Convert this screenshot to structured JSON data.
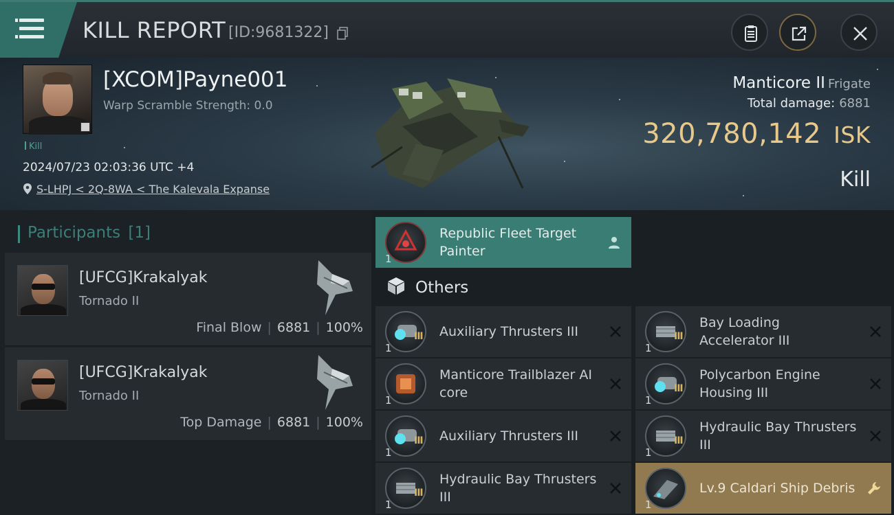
{
  "header": {
    "title": "KILL REPORT",
    "report_id": "[ID:9681322]"
  },
  "victim": {
    "name": "[XCOM]Payne001",
    "warp_scramble": "Warp Scramble Strength: 0.0",
    "kill_tag": "Kill",
    "timestamp": "2024/07/23 02:03:36 UTC +4",
    "location": "S-LHPJ < 2Q-8WA < The Kalevala Expanse"
  },
  "summary": {
    "ship": "Manticore II",
    "ship_class": "Frigate",
    "total_damage_label": "Total damage:",
    "total_damage": "6881",
    "isk_value": "320,780,142",
    "isk_unit": "ISK",
    "result": "Kill"
  },
  "participants": {
    "title": "Participants",
    "count": "[1]",
    "rows": [
      {
        "name": "[UFCG]Krakalyak",
        "ship": "Tornado II",
        "label": "Final Blow",
        "damage": "6881",
        "percent": "100%"
      },
      {
        "name": "[UFCG]Krakalyak",
        "ship": "Tornado II",
        "label": "Top Damage",
        "damage": "6881",
        "percent": "100%"
      }
    ]
  },
  "items": {
    "top": {
      "name": "Republic Fleet Target Painter",
      "qty": "1"
    },
    "others_label": "Others",
    "list": [
      {
        "name": "Auxiliary Thrusters III",
        "qty": "1",
        "tier": "III"
      },
      {
        "name": "Bay Loading Accelerator III",
        "qty": "1",
        "tier": "III"
      },
      {
        "name": "Manticore Trailblazer AI core",
        "qty": "1",
        "tier": ""
      },
      {
        "name": "Polycarbon Engine Housing III",
        "qty": "1",
        "tier": "III"
      },
      {
        "name": "Auxiliary Thrusters III",
        "qty": "1",
        "tier": "III"
      },
      {
        "name": "Hydraulic Bay Thrusters III",
        "qty": "1",
        "tier": "III"
      },
      {
        "name": "Hydraulic Bay Thrusters III",
        "qty": "1",
        "tier": "III"
      },
      {
        "name": "Lv.9 Caldari Ship Debris",
        "qty": "1",
        "tier": ""
      }
    ]
  },
  "colors": {
    "accent_teal": "#3a7d74",
    "isk_gold": "#e8c98a",
    "debris_highlight": "#927a50"
  }
}
